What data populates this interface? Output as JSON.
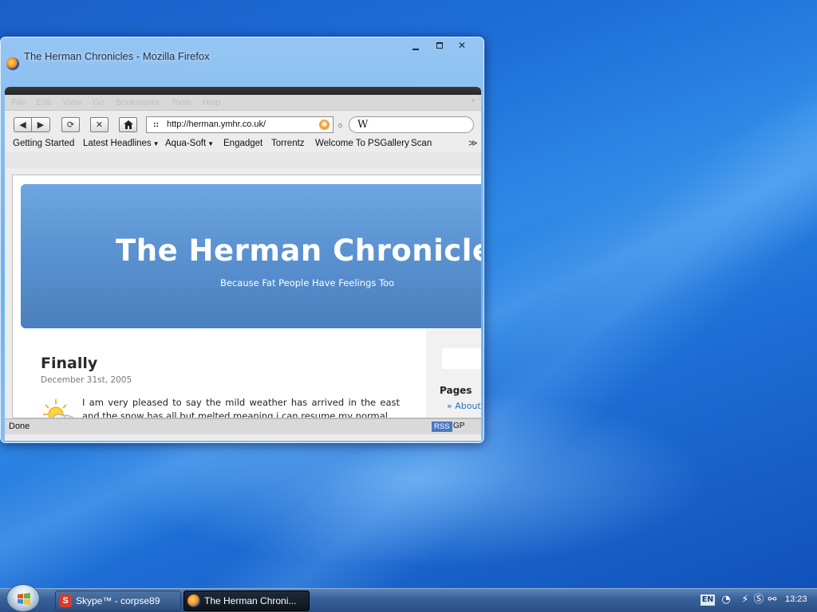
{
  "window": {
    "title": "The Herman Chronicles - Mozilla Firefox"
  },
  "menubar": {
    "items": [
      "File",
      "Edit",
      "View",
      "Go",
      "Bookmarks",
      "Tools",
      "Help"
    ]
  },
  "navbar": {
    "url": "http://herman.ymhr.co.uk/",
    "search_engine_label": "W"
  },
  "bookmarks": [
    {
      "label": "Getting Started",
      "folder": false
    },
    {
      "label": "Latest Headlines",
      "folder": true
    },
    {
      "label": "Aqua-Soft",
      "folder": true
    },
    {
      "label": "Engadget",
      "folder": false
    },
    {
      "label": "Torrentz",
      "folder": false
    },
    {
      "label": "Welcome To PSGallery",
      "folder": false
    },
    {
      "label": "Scan",
      "folder": false
    }
  ],
  "page": {
    "blog_title": "The Herman Chronicle",
    "tagline": "Because Fat People Have Feelings Too",
    "post": {
      "title": "Finally",
      "date": "December 31st, 2005",
      "body": "I am very pleased to say the mild weather has arrived in the east and the snow has all but melted meaning i can resume my normal"
    },
    "sidebar": {
      "heading": "Pages",
      "link": "» About"
    }
  },
  "statusbar": {
    "text": "Done",
    "rss": "RSS",
    "gp": "GP"
  },
  "taskbar": {
    "buttons": [
      {
        "label": "Skype™ - corpse89",
        "icon": "skype-icon"
      },
      {
        "label": "The Herman Chroni...",
        "icon": "firefox-icon"
      }
    ],
    "tray": {
      "language": "EN",
      "clock": "13:23"
    }
  },
  "colors": {
    "desktop": "#1e6fd8",
    "blog_header": "#5b93d2",
    "link": "#2a6fb8",
    "taskbar": "#3a629b"
  }
}
